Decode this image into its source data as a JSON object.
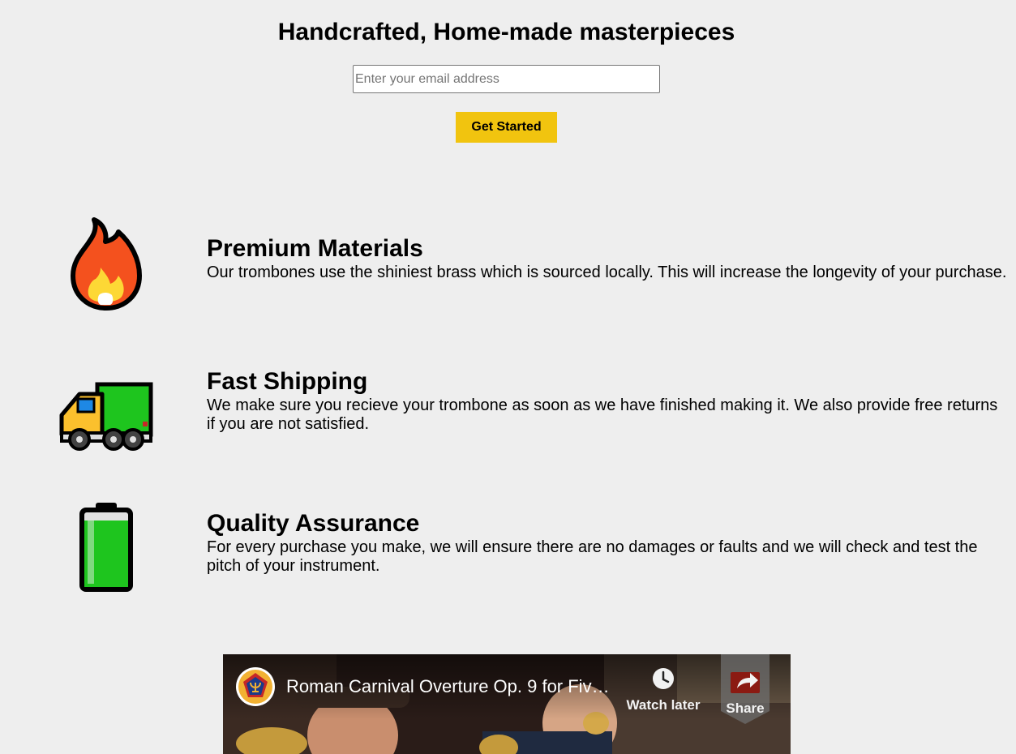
{
  "hero": {
    "title": "Handcrafted, Home-made masterpieces",
    "email_placeholder": "Enter your email address",
    "email_value": "",
    "cta_label": "Get Started",
    "cta_color": "#f1c40f"
  },
  "features": [
    {
      "icon": "fire-icon",
      "title": "Premium Materials",
      "description": "Our trombones use the shiniest brass which is sourced locally. This will increase the longevity of your purchase."
    },
    {
      "icon": "delivery-truck-icon",
      "title": "Fast Shipping",
      "description": "We make sure you recieve your trombone as soon as we have finished making it. We also provide free returns if you are not satisfied."
    },
    {
      "icon": "battery-full-icon",
      "title": "Quality Assurance",
      "description": "For every purchase you make, we will ensure there are no damages or faults and we will check and test the pitch of your instrument."
    }
  ],
  "video": {
    "title": "Roman Carnival Overture Op. 9 for Five ...",
    "watch_later_label": "Watch later",
    "share_label": "Share"
  }
}
